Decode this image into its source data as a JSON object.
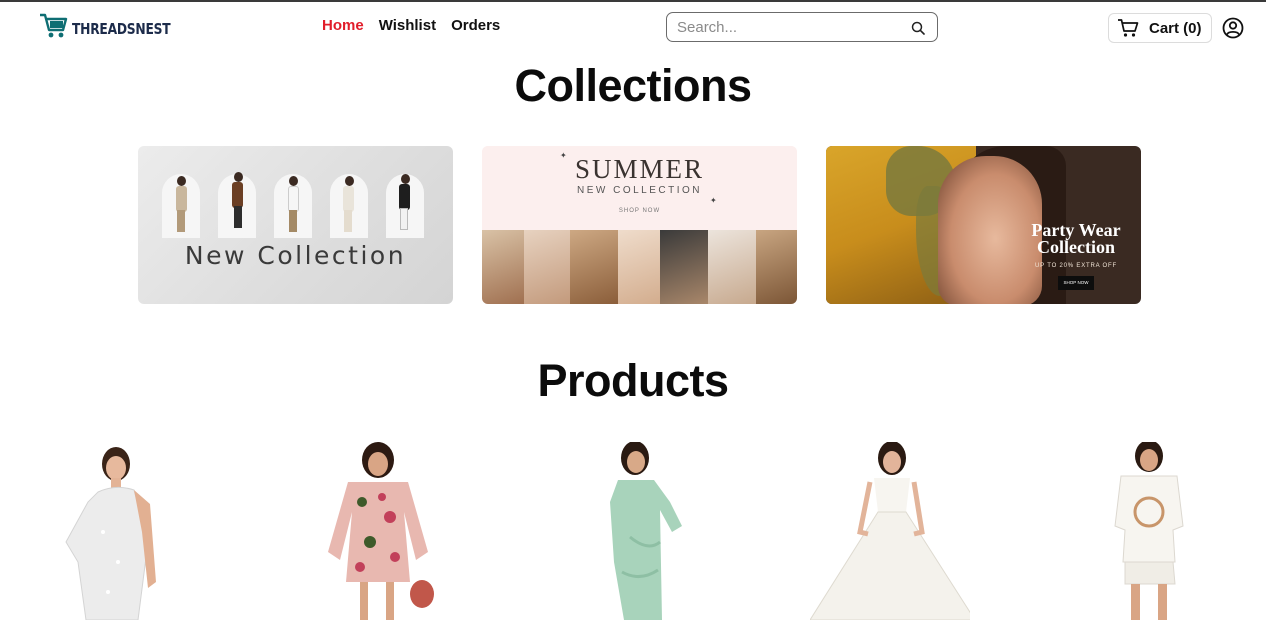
{
  "brand": {
    "name": "THREADSNEST",
    "accent": "#0e6e73"
  },
  "nav": {
    "items": [
      "Home",
      "Wishlist",
      "Orders"
    ],
    "active": "Home",
    "active_color": "#e11d2a"
  },
  "search": {
    "placeholder": "Search...",
    "value": ""
  },
  "cart": {
    "label": "Cart (0)"
  },
  "sections": {
    "collections_title": "Collections",
    "products_title": "Products"
  },
  "collections": [
    {
      "title": "New Collection"
    },
    {
      "title": "SUMMER",
      "subtitle": "NEW COLLECTION",
      "cta": "SHOP NOW"
    },
    {
      "title_line1": "Party Wear",
      "title_line2": "Collection",
      "offer": "UP TO 20% EXTRA OFF",
      "cta": "SHOP NOW"
    }
  ],
  "products": [
    {
      "icon": "white-sequin-one-shoulder-dress"
    },
    {
      "icon": "floral-cold-shoulder-dress"
    },
    {
      "icon": "mint-green-drape-gown"
    },
    {
      "icon": "white-ball-gown"
    },
    {
      "icon": "white-tshirt-shorts-set"
    }
  ]
}
